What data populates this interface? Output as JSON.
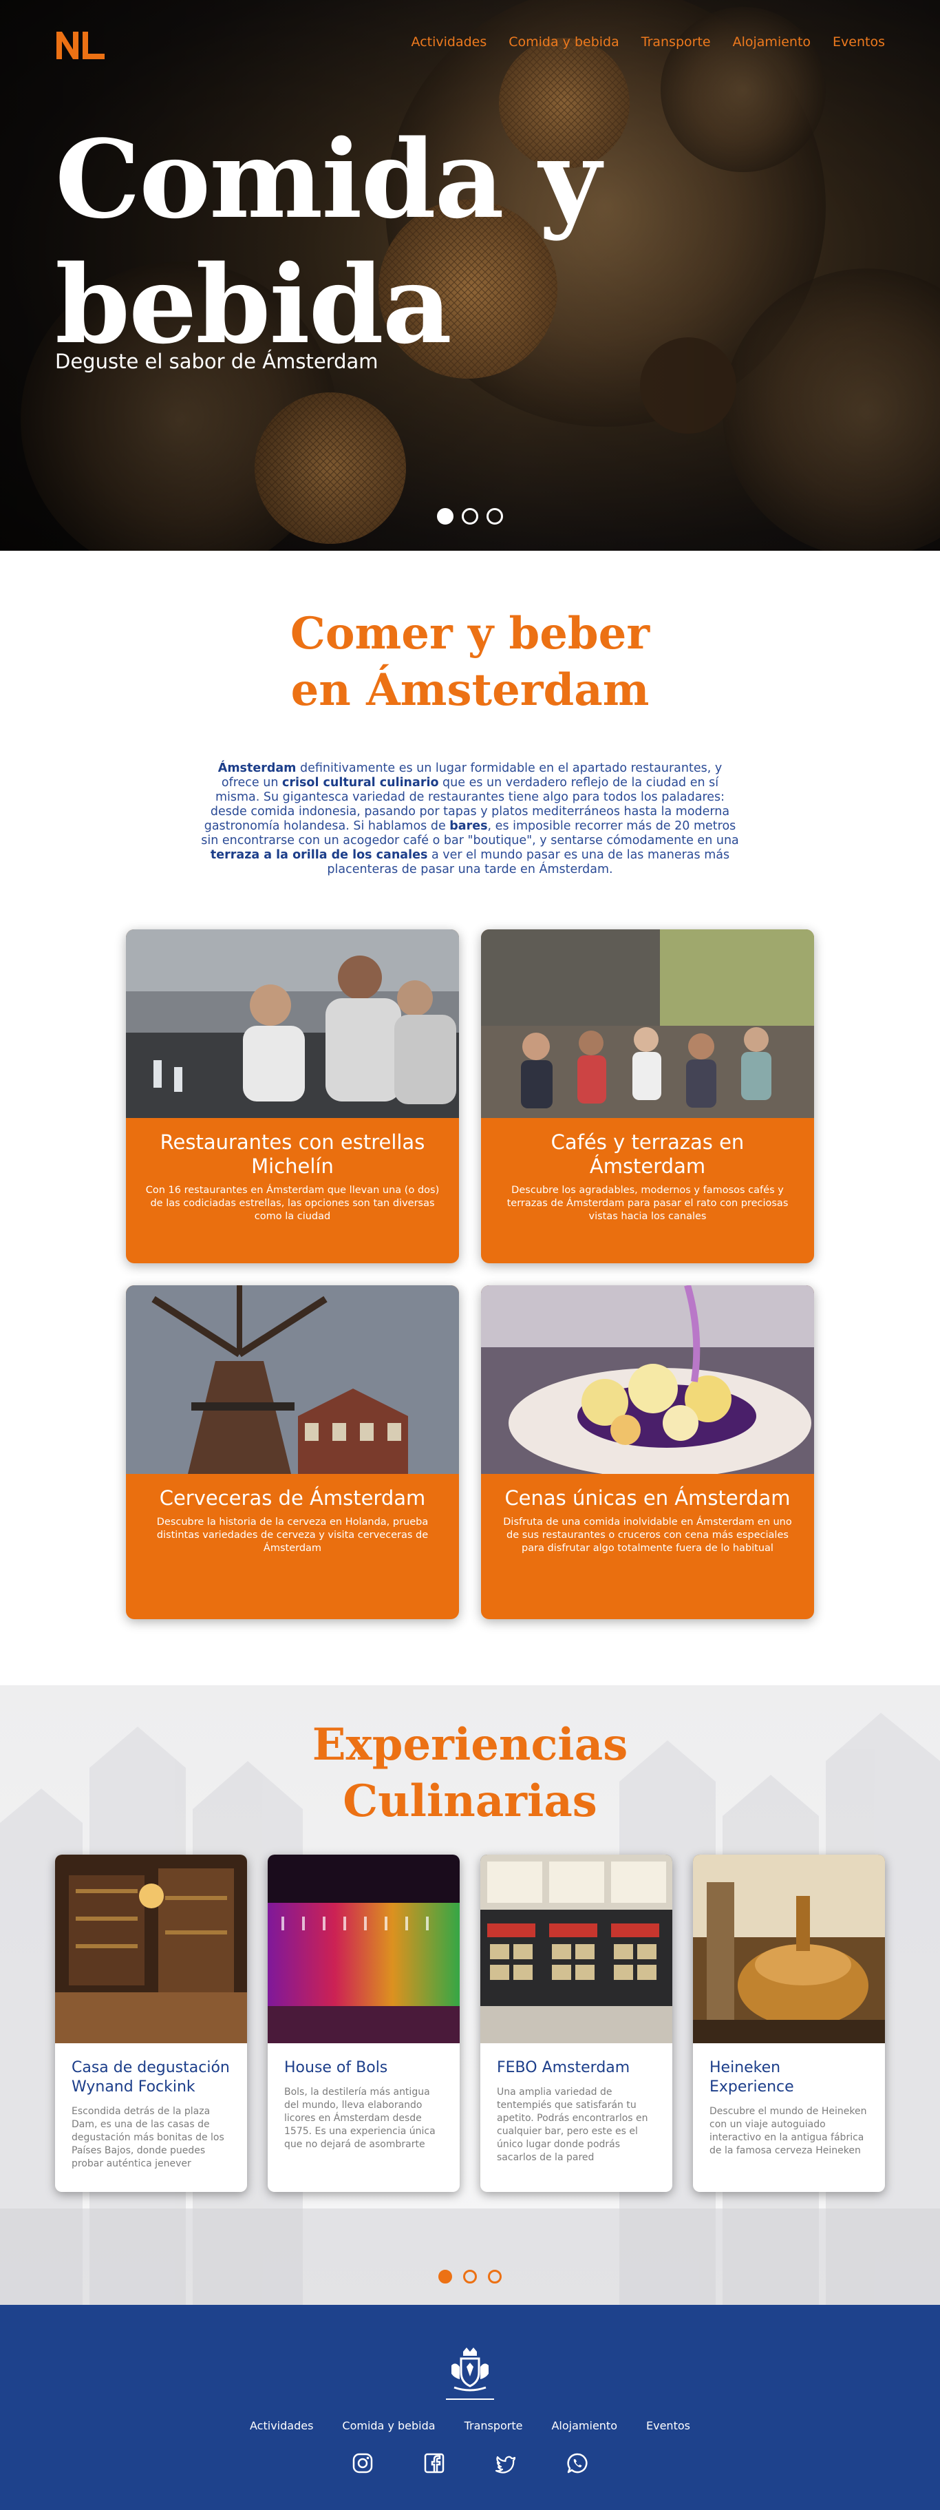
{
  "brand": {
    "logo_text": "NL",
    "accent": "#ec7114",
    "navy": "#1e428c"
  },
  "nav": [
    "Actividades",
    "Comida y bebida",
    "Transporte",
    "Alojamiento",
    "Eventos"
  ],
  "hero": {
    "title_line1": "Comida y",
    "title_line2": "bebida",
    "subtitle": "Deguste el sabor de Ámsterdam",
    "slides_total": 3,
    "slide_active": 1
  },
  "intro": {
    "title_line1": "Comer y beber",
    "title_line2": "en Ámsterdam",
    "p1": "Ámsterdam",
    "p2": " definitivamente es un lugar formidable en el apartado restaurantes, y ofrece un ",
    "p3": "crisol cultural culinario",
    "p4": " que es un verdadero reflejo de la ciudad en sí misma. Su gigantesca variedad de restaurantes tiene algo para todos los paladares: desde comida indonesia, pasando por tapas y platos mediterráneos hasta la moderna gastronomía holandesa. Si hablamos de ",
    "p5": "bares",
    "p6": ", es imposible recorrer más de 20 metros sin encontrarse con un acogedor café o bar \"boutique\", y sentarse cómodamente en una ",
    "p7": "terraza a la orilla de los canales",
    "p8": " a ver el mundo pasar es una de las maneras más placenteras de pasar una tarde en Ámsterdam."
  },
  "food_cards": [
    {
      "title": "Restaurantes con estrellas Michelín",
      "text": "Con 16 restaurantes en Ámsterdam que llevan una (o dos) de las codiciadas estrellas, las opciones son tan diversas como la ciudad"
    },
    {
      "title": "Cafés y terrazas en Ámsterdam",
      "text": "Descubre los agradables, modernos y famosos cafés y terrazas de Ámsterdam para pasar el rato con preciosas vistas hacia los canales"
    },
    {
      "title": "Cerveceras de Ámsterdam",
      "text": "Descubre la historia de la cerveza en Holanda, prueba distintas variedades de cerveza y visita cerveceras de Ámsterdam"
    },
    {
      "title": "Cenas únicas en Ámsterdam",
      "text": "Disfruta de una comida inolvidable en Ámsterdam en uno de sus restaurantes o cruceros con cena más especiales para disfrutar algo totalmente fuera de lo habitual"
    }
  ],
  "experiences": {
    "title_line1": "Experiencias",
    "title_line2": "Culinarias",
    "cards": [
      {
        "title": "Casa de degustación Wynand Fockink",
        "text": "Escondida detrás de la plaza Dam, es una de las casas de degustación más bonitas de los Países Bajos, donde puedes probar auténtica jenever"
      },
      {
        "title": "House of Bols",
        "text": "Bols, la destilería más antigua del mundo, lleva elaborando licores en Ámsterdam desde 1575. Es una experiencia única que no dejará de asombrarte"
      },
      {
        "title": "FEBO Amsterdam",
        "text": "Una amplia variedad de tentempiés que satisfarán tu apetito. Podrás encontrarlos en cualquier bar, pero este es el único lugar donde podrás sacarlos de la pared"
      },
      {
        "title": "Heineken Experience",
        "text": "Descubre el mundo de Heineken con un viaje autoguiado interactivo en la antigua fábrica de la famosa cerveza Heineken"
      }
    ],
    "slides_total": 3,
    "slide_active": 1
  },
  "footer": {
    "nav": [
      "Actividades",
      "Comida y bebida",
      "Transporte",
      "Alojamiento",
      "Eventos"
    ],
    "social": [
      "instagram-icon",
      "facebook-icon",
      "twitter-icon",
      "whatsapp-icon"
    ]
  }
}
